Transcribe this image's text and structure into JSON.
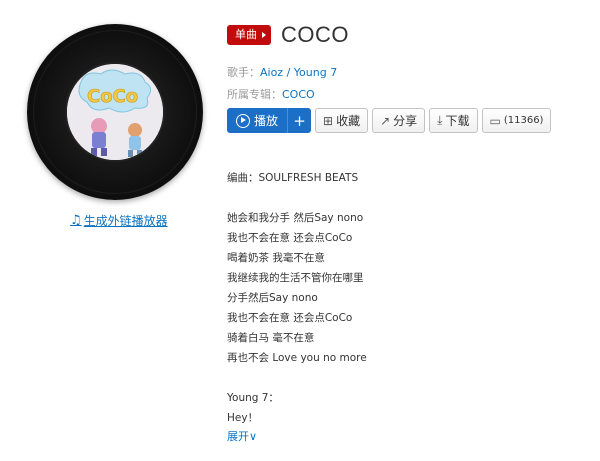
{
  "player": {
    "cover_text": "CoCo",
    "external_link": "生成外链播放器"
  },
  "song": {
    "badge": "单曲",
    "title": "COCO",
    "singer_label": "歌手：",
    "singers": "Aioz / Young 7",
    "album_label": "所属专辑：",
    "album": "COCO"
  },
  "actions": {
    "play": "播放",
    "add": "+",
    "collect": "收藏",
    "share": "分享",
    "download": "下载",
    "comments": "(11366)"
  },
  "lyrics": {
    "arranger": "编曲：SOULFRESH BEATS",
    "lines": [
      "她会和我分手 然后Say nono",
      "我也不会在意 还会点CoCo",
      "喝着奶茶 我毫不在意",
      "我继续我的生活不管你在哪里",
      "分手然后Say nono",
      "我也不会在意 还会点CoCo",
      "骑着白马 毫不在意",
      "再也不会 Love you no more"
    ],
    "singer2": "Young 7：",
    "line2": "Hey！",
    "expand": "展开"
  },
  "colors": {
    "accent": "#c20c0c",
    "link": "#0c73c2",
    "play": "#1b6fc7"
  }
}
